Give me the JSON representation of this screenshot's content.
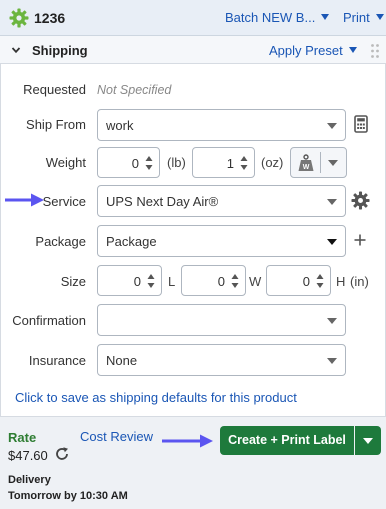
{
  "header": {
    "order_number": "1236",
    "batch_label": "Batch NEW B...",
    "print_label": "Print"
  },
  "section": {
    "title": "Shipping",
    "apply_preset_label": "Apply Preset"
  },
  "form": {
    "requested": {
      "label": "Requested",
      "value": "Not Specified"
    },
    "ship_from": {
      "label": "Ship From",
      "value": "work"
    },
    "weight": {
      "label": "Weight",
      "lb_value": "0",
      "lb_unit": "(lb)",
      "oz_value": "1",
      "oz_unit": "(oz)"
    },
    "service": {
      "label": "Service",
      "value": "UPS Next Day Air®"
    },
    "package": {
      "label": "Package",
      "value": "Package"
    },
    "size": {
      "label": "Size",
      "l_value": "0",
      "l_unit": "L",
      "w_value": "0",
      "w_unit": "W",
      "h_value": "0",
      "h_unit": "H",
      "units": "(in)"
    },
    "confirmation": {
      "label": "Confirmation",
      "value": ""
    },
    "insurance": {
      "label": "Insurance",
      "value": "None"
    },
    "defaults_link": "Click to save as shipping defaults for this product"
  },
  "footer": {
    "rate_label": "Rate",
    "rate_value": "$47.60",
    "cost_review_label": "Cost Review",
    "delivery_label": "Delivery",
    "delivery_value": "Tomorrow by 10:30 AM",
    "create_button_label": "Create + Print Label"
  },
  "colors": {
    "accent": "#1a56b5",
    "primary_button": "#1e7a3c",
    "rate_green": "#2e7d32",
    "annotation_arrow": "#5b55f0"
  },
  "icons": {
    "settings": "gear-icon",
    "collapse": "chevron-down-icon",
    "drag": "drag-handle-icon",
    "calculator": "calculator-icon",
    "scale": "scale-icon",
    "service_settings": "gear-icon",
    "add": "plus-icon",
    "refresh": "refresh-icon"
  }
}
